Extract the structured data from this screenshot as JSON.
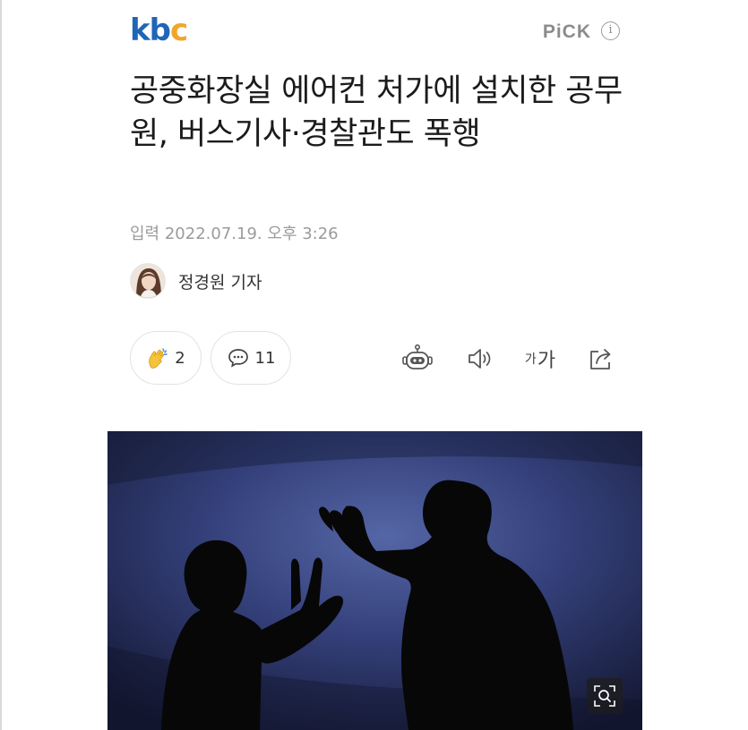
{
  "header": {
    "logo": {
      "k": "k",
      "b": "b",
      "c": "c"
    },
    "pick_label": "PiCK",
    "info_glyph": "i",
    "brand_colors": {
      "blue": "#1f66b6",
      "orange": "#f1a52a"
    }
  },
  "article": {
    "headline": "공중화장실 에어컨 처가에 설치한 공무원, 버스기사·경찰관도 폭행",
    "date_label": "입력",
    "date_value": "2022.07.19. 오후 3:26",
    "reporter": "정경원 기자"
  },
  "actions": {
    "like_count": "2",
    "comment_count": "11",
    "font_small": "가",
    "font_large": "가"
  },
  "icons": [
    "info-icon",
    "clap-icon",
    "comment-icon",
    "robot-icon",
    "speaker-icon",
    "font-size-icon",
    "share-icon",
    "zoom-icon"
  ]
}
